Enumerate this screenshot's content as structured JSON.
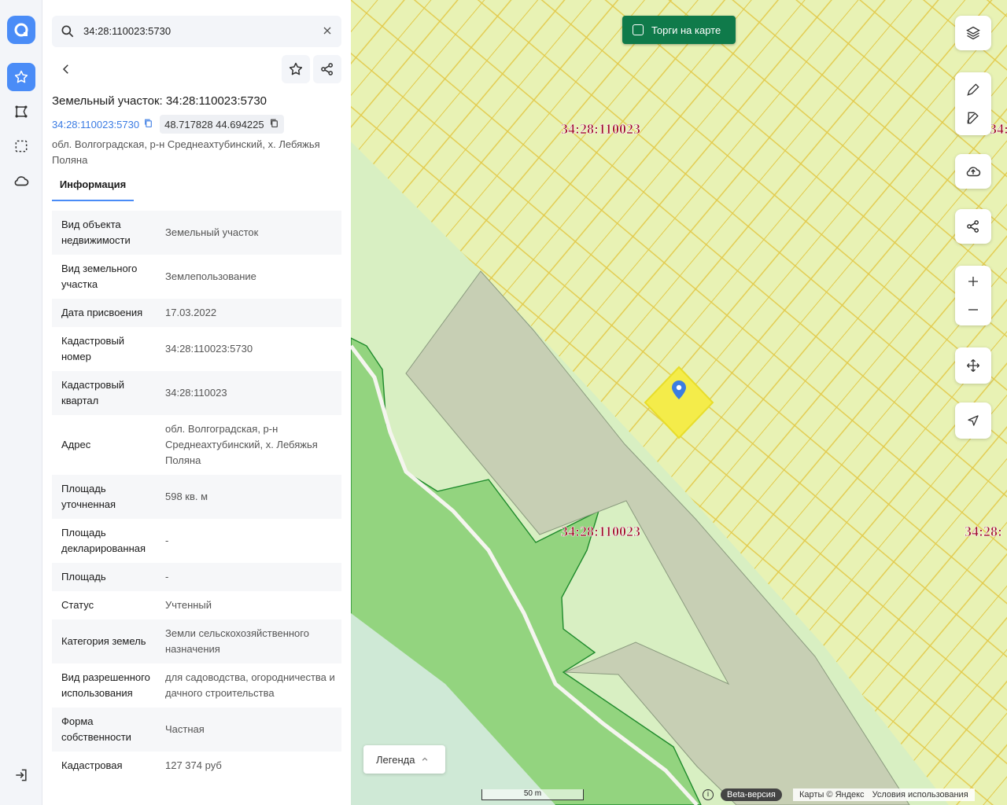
{
  "search": {
    "value": "34:28:110023:5730"
  },
  "header": {
    "title": "Земельный участок: 34:28:110023:5730",
    "cad_link": "34:28:110023:5730",
    "coords": "48.717828 44.694225",
    "address": "обл. Волгоградская, р-н Среднеахтубинский, х. Лебяжья Поляна"
  },
  "tabs": [
    {
      "label": "Информация"
    }
  ],
  "info_rows": [
    {
      "key": "Вид объекта недвижимости",
      "value": "Земельный участок"
    },
    {
      "key": "Вид земельного участка",
      "value": "Землепользование"
    },
    {
      "key": "Дата присвоения",
      "value": "17.03.2022"
    },
    {
      "key": "Кадастровый номер",
      "value": "34:28:110023:5730"
    },
    {
      "key": "Кадастровый квартал",
      "value": "34:28:110023"
    },
    {
      "key": "Адрес",
      "value": "обл. Волгоградская, р-н Среднеахтубинский, х. Лебяжья Поляна"
    },
    {
      "key": "Площадь уточненная",
      "value": "598 кв. м"
    },
    {
      "key": "Площадь декларированная",
      "value": "-"
    },
    {
      "key": "Площадь",
      "value": "-"
    },
    {
      "key": "Статус",
      "value": "Учтенный"
    },
    {
      "key": "Категория земель",
      "value": "Земли сельскохозяйственного назначения"
    },
    {
      "key": "Вид разрешенного использования",
      "value": "для садоводства, огородничества и дачного строительства"
    },
    {
      "key": "Форма собственности",
      "value": "Частная"
    },
    {
      "key": "Кадастровая",
      "value": "127 374 руб"
    }
  ],
  "map": {
    "auction_label": "Торги на карте",
    "quarter_labels": [
      "34:28:110023",
      "34:28:110023",
      "34:28:",
      "34:28:"
    ],
    "legend_label": "Легенда",
    "scale_label": "50 m",
    "beta_label": "Beta-версия",
    "attribution": "Карты © Яндекс",
    "terms": "Условия использования",
    "info_glyph": "i"
  },
  "colors": {
    "accent": "#4a8cf7",
    "auction_bg": "#0f7a4a",
    "quarter_label": "#a0102a",
    "parcel_line": "#e2c94a"
  }
}
